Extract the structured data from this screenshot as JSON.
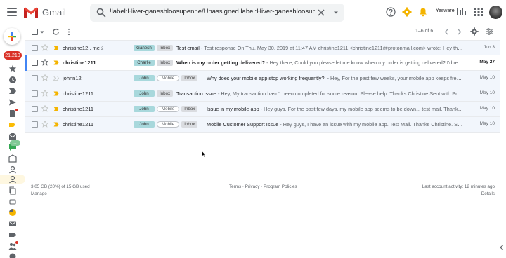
{
  "app": {
    "name": "Gmail"
  },
  "search": {
    "query": "!label:Hiver-ganeshloosupenne/Unassigned label:Hiver-ganeshloosupenne/open"
  },
  "header": {
    "yesware_label": "Yesware"
  },
  "rail": {
    "badge": "21,210",
    "chat_badge": "..."
  },
  "toolbar": {
    "count": "1–6 of 6"
  },
  "emails": [
    {
      "sender": "christine12., me",
      "sender_count": "2",
      "person_label": "Ganesh",
      "has_mobile": false,
      "folder": "Inbox",
      "subject": "Test email",
      "snippet": " - Test response On Thu, May 30, 2019 at 11:47 AM christine1211 <christine1211@protonmail.com> wrote: Hey the...",
      "date": "Jun 3",
      "unread": false,
      "starred": false
    },
    {
      "sender": "christine1211",
      "sender_count": "",
      "person_label": "Charlie",
      "has_mobile": false,
      "folder": "Inbox",
      "subject": "When is my order getting delivered?",
      "snippet": " - Hey there, Could you please let me know when my order is getting delivered? I'd really a...",
      "date": "May 27",
      "unread": true,
      "starred": false
    },
    {
      "sender": "johnn12",
      "sender_count": "",
      "person_label": "John",
      "has_mobile": true,
      "mobile_label": "Mobile",
      "folder": "Inbox",
      "subject": "Why does your mobile app stop working frequently?!",
      "snippet": " - Hey, For the past few weeks, your mobile app keeps freezi...",
      "date": "May 10",
      "unread": false,
      "starred": false
    },
    {
      "sender": "christine1211",
      "sender_count": "",
      "person_label": "John",
      "has_mobile": false,
      "folder": "Inbox",
      "subject": "Transaction issue",
      "snippet": " - Hey, My transaction hasn't been completed for some reason. Please help. Thanks Christine Sent with Prot...",
      "date": "May 10",
      "unread": false,
      "starred": false
    },
    {
      "sender": "christine1211",
      "sender_count": "",
      "person_label": "John",
      "has_mobile": true,
      "mobile_label": "Mobile",
      "folder": "Inbox",
      "subject": "Issue in my mobile app",
      "snippet": " - Hey guys, For the past few days, my mobile app seems to be down... test mail. Thanks ...",
      "date": "May 10",
      "unread": false,
      "starred": false
    },
    {
      "sender": "christine1211",
      "sender_count": "",
      "person_label": "John",
      "has_mobile": true,
      "mobile_label": "Mobile",
      "folder": "Inbox",
      "subject": "Mobile Customer Support Issue",
      "snippet": " - Hey guys, I have an issue with my mobile app. Test Mail. Thanks Christine. Sen...",
      "date": "May 10",
      "unread": false,
      "starred": false
    }
  ],
  "footer": {
    "storage": "3.05 GB (20%) of 15 GB used",
    "manage": "Manage",
    "terms": "Terms",
    "privacy": "Privacy",
    "policies": "Program Policies",
    "sep": " · ",
    "activity": "Last account activity: 12 minutes ago",
    "details": "Details"
  },
  "colors": {
    "person_chip": "#a8d8dc",
    "importance": "#f4b400",
    "badge": "#d93025",
    "active_rail": "#fef7e0"
  }
}
